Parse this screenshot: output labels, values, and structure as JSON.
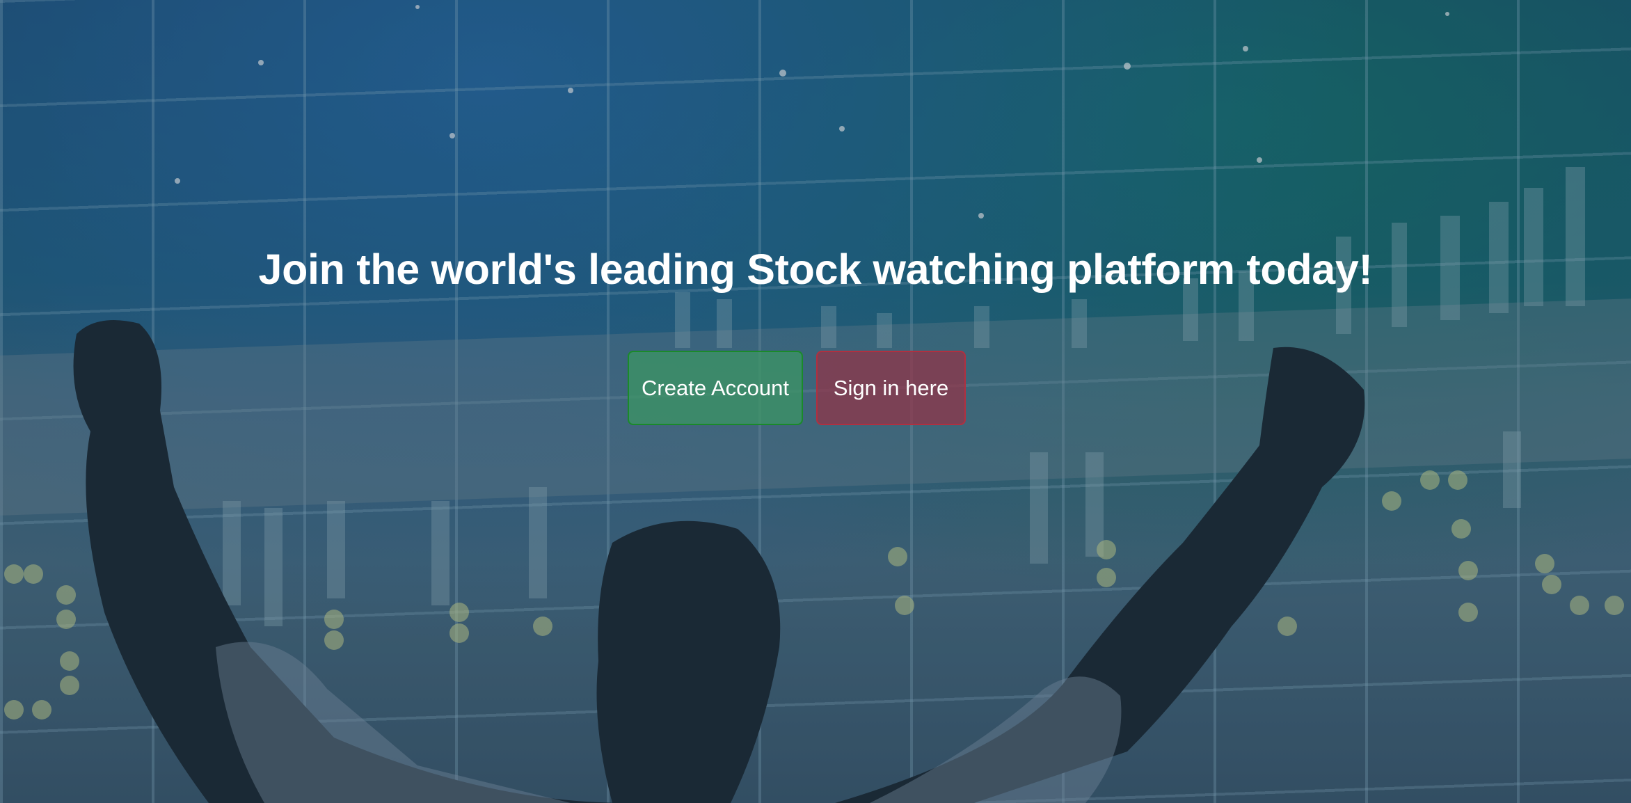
{
  "hero": {
    "title": "Join the world's leading Stock watching platform today!",
    "create_account_label": "Create Account",
    "sign_in_label": "Sign in here"
  },
  "colors": {
    "create": "#3c9664",
    "signin": "#963246"
  }
}
